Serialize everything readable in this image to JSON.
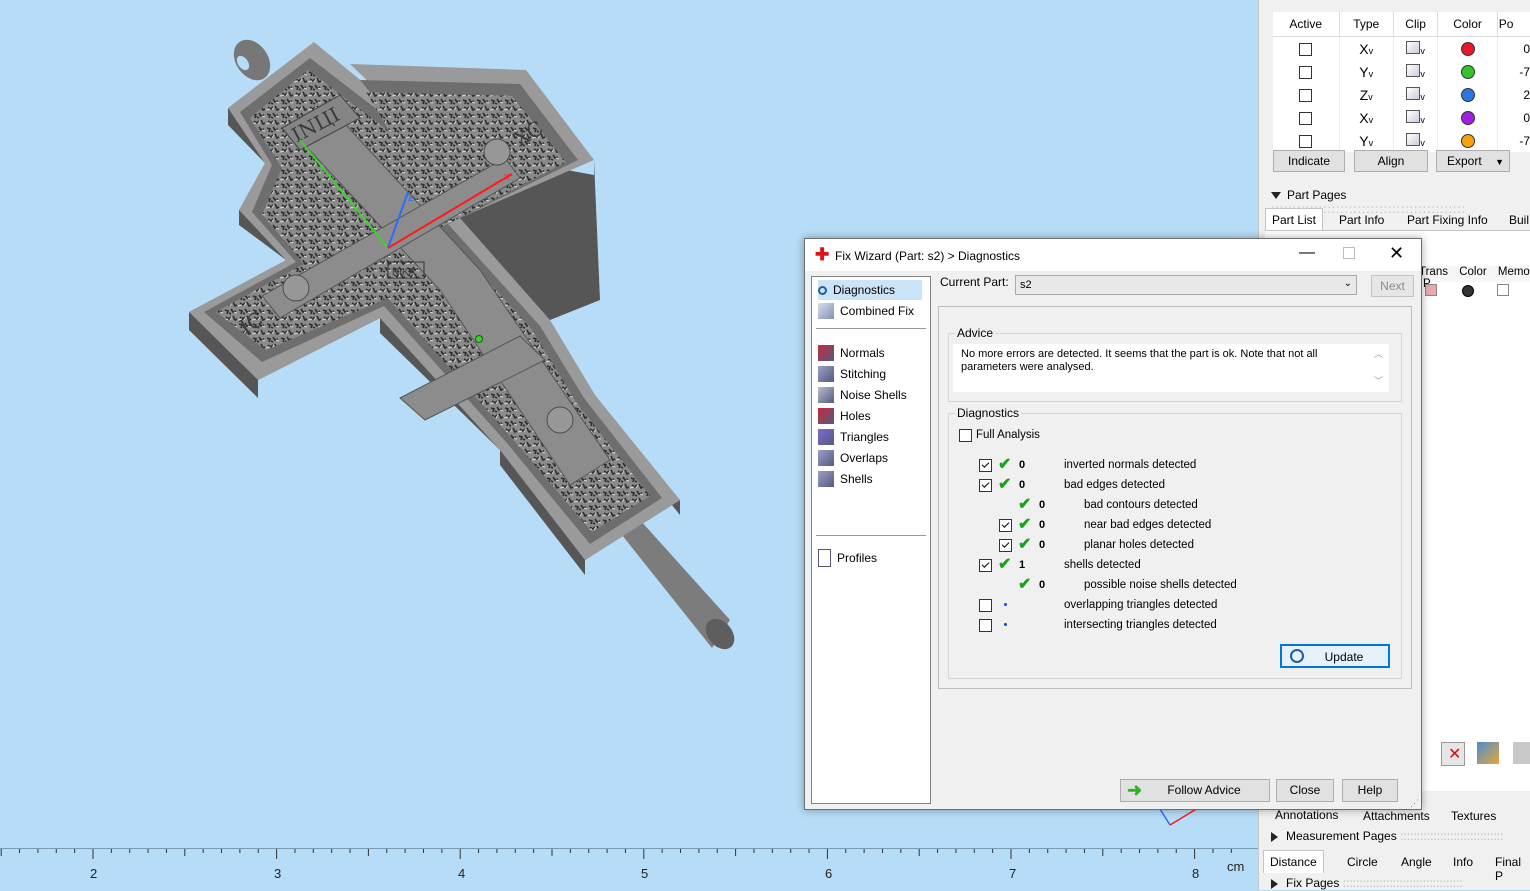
{
  "viewport": {
    "axis_labels": {
      "z": "z",
      "x": "x"
    },
    "ruler": {
      "ticks": [
        "2",
        "3",
        "4",
        "5",
        "6",
        "7",
        "8"
      ],
      "unit": "cm"
    },
    "model_text": {
      "top": "INЦI",
      "right": "XC",
      "left": "IC",
      "mid": "NIKA"
    }
  },
  "clip_panel": {
    "headers": [
      "Active",
      "Type",
      "Clip",
      "Color",
      "Po"
    ],
    "rows": [
      {
        "type": "X",
        "active": false,
        "color": "#e8182a",
        "pos": "0"
      },
      {
        "type": "Y",
        "active": false,
        "color": "#34c32a",
        "pos": "-7"
      },
      {
        "type": "Z",
        "active": false,
        "color": "#2a76e0",
        "pos": "2"
      },
      {
        "type": "X",
        "active": false,
        "color": "#a01fe0",
        "pos": "0"
      },
      {
        "type": "Y",
        "active": false,
        "color": "#f5a20f",
        "pos": "-7"
      }
    ],
    "buttons": {
      "indicate": "Indicate",
      "align": "Align",
      "export": "Export"
    }
  },
  "part_pages": {
    "title": "Part Pages",
    "tabs": [
      "Part List",
      "Part Info",
      "Part Fixing Info",
      "Buil"
    ],
    "list_headers": [
      "Trans",
      "Color",
      "Memo",
      "P"
    ]
  },
  "bottom_tabs": [
    "Annotations",
    "Attachments",
    "Textures"
  ],
  "measurement": {
    "title": "Measurement Pages",
    "tabs": [
      "Distance",
      "Circle",
      "Angle",
      "Info",
      "Final P"
    ]
  },
  "fix_pages": {
    "title": "Fix Pages"
  },
  "dialog": {
    "title": "Fix Wizard (Part: s2) > Diagnostics",
    "current_part_label": "Current Part:",
    "current_part_value": "s2",
    "next_label": "Next",
    "advice_title": "Advice",
    "advice_text": "No more errors are detected. It seems that the part is ok. Note that not all parameters were analysed.",
    "diagnostics_title": "Diagnostics",
    "full_analysis": "Full Analysis",
    "update_label": "Update",
    "follow_label": "Follow Advice",
    "close_label": "Close",
    "help_label": "Help",
    "side": {
      "top": [
        "Diagnostics",
        "Combined Fix"
      ],
      "mid": [
        "Normals",
        "Stitching",
        "Noise Shells",
        "Holes",
        "Triangles",
        "Overlaps",
        "Shells"
      ],
      "bottom": [
        "Profiles"
      ]
    },
    "checks": [
      {
        "label": "inverted normals detected",
        "value": "0",
        "checked": true,
        "indent": 0,
        "status": "ok"
      },
      {
        "label": "bad edges detected",
        "value": "0",
        "checked": true,
        "indent": 0,
        "status": "ok"
      },
      {
        "label": "bad contours detected",
        "value": "0",
        "checked": null,
        "indent": 1,
        "status": "ok"
      },
      {
        "label": "near bad edges detected",
        "value": "0",
        "checked": true,
        "indent": 1,
        "status": "ok"
      },
      {
        "label": "planar holes detected",
        "value": "0",
        "checked": true,
        "indent": 1,
        "status": "ok"
      },
      {
        "label": "shells detected",
        "value": "1",
        "checked": true,
        "indent": 0,
        "status": "ok"
      },
      {
        "label": "possible noise shells detected",
        "value": "0",
        "checked": null,
        "indent": 1,
        "status": "ok"
      },
      {
        "label": "overlapping triangles detected",
        "value": "",
        "checked": false,
        "indent": 0,
        "status": "dot"
      },
      {
        "label": "intersecting triangles detected",
        "value": "",
        "checked": false,
        "indent": 0,
        "status": "dot"
      }
    ]
  }
}
